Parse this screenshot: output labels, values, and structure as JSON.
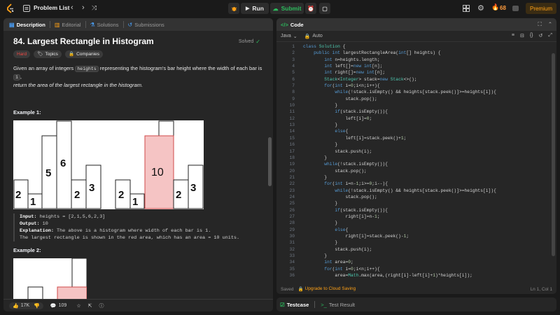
{
  "topbar": {
    "problem_list": "Problem List",
    "run": "Run",
    "submit": "Submit",
    "streak": "68",
    "premium": "Premium"
  },
  "left_tabs": {
    "description": "Description",
    "editorial": "Editorial",
    "solutions": "Solutions",
    "submissions": "Submissions"
  },
  "problem": {
    "title": "84. Largest Rectangle in Histogram",
    "status": "Solved",
    "difficulty": "Hard",
    "topics": "Topics",
    "companies": "Companies",
    "statement_1": "Given an array of integers ",
    "statement_code": "heights",
    "statement_2": " representing the histogram's bar height where the width of each bar is ",
    "statement_code2": "1",
    "statement_3": ",",
    "statement_4": "return the area of the largest rectangle in the histogram.",
    "example1": "Example 1:",
    "example2": "Example 2:",
    "ex_input_label": "Input:",
    "ex_input": " heights = [2,1,5,6,2,3]",
    "ex_output_label": "Output:",
    "ex_output": " 10",
    "ex_expl_label": "Explanation:",
    "ex_expl": " The above is a histogram where width of each bar is 1.",
    "ex_expl2": "The largest rectangle is shown in the red area, which has an area = 10 units.",
    "hist_labels": [
      "2",
      "1",
      "5",
      "6",
      "2",
      "3",
      "2",
      "1",
      "10",
      "2",
      "3"
    ]
  },
  "footer": {
    "likes": "17K",
    "comments": "109"
  },
  "code_panel": {
    "title": "Code",
    "language": "Java",
    "auto": "Auto",
    "saved": "Saved",
    "upgrade": "Upgrade to Cloud Saving",
    "cursor": "Ln 1, Col 1"
  },
  "test_panel": {
    "testcase": "Testcase",
    "test_result": "Test Result"
  },
  "code": [
    "class Solution {",
    "    public int largestRectangleArea(int[] heights) {",
    "        int n=heights.length;",
    "        int left[]=new int[n];",
    "        int right[]=new int[n];",
    "        Stack<Integer> stack=new Stack<>();",
    "        for(int i=0;i<n;i++){",
    "            while(!stack.isEmpty() && heights[stack.peek()]>=heights[i]){",
    "                stack.pop();",
    "            }",
    "            if(stack.isEmpty()){",
    "                left[i]=0;",
    "            }",
    "            else{",
    "                left[i]=stack.peek()+1;",
    "            }",
    "            stack.push(i);",
    "        }",
    "        while(!stack.isEmpty()){",
    "            stack.pop();",
    "        }",
    "        for(int i=n-1;i>=0;i--){",
    "            while(!stack.isEmpty() && heights[stack.peek()]>=heights[i]){",
    "                stack.pop();",
    "            }",
    "            if(stack.isEmpty()){",
    "                right[i]=n-1;",
    "            }",
    "            else{",
    "                right[i]=stack.peek()-1;",
    "            }",
    "            stack.push(i);",
    "        }",
    "        int area=0;",
    "        for(int i=0;i<n;i++){",
    "            area=Math.max(area,(right[i]-left[i]+1)*heights[i]);"
  ],
  "colors": {
    "bg": "#1a1a1a",
    "panel": "#262626",
    "accent_green": "#2cbb5d",
    "hard": "#ef4743",
    "run_highlight": "#ffa116"
  }
}
